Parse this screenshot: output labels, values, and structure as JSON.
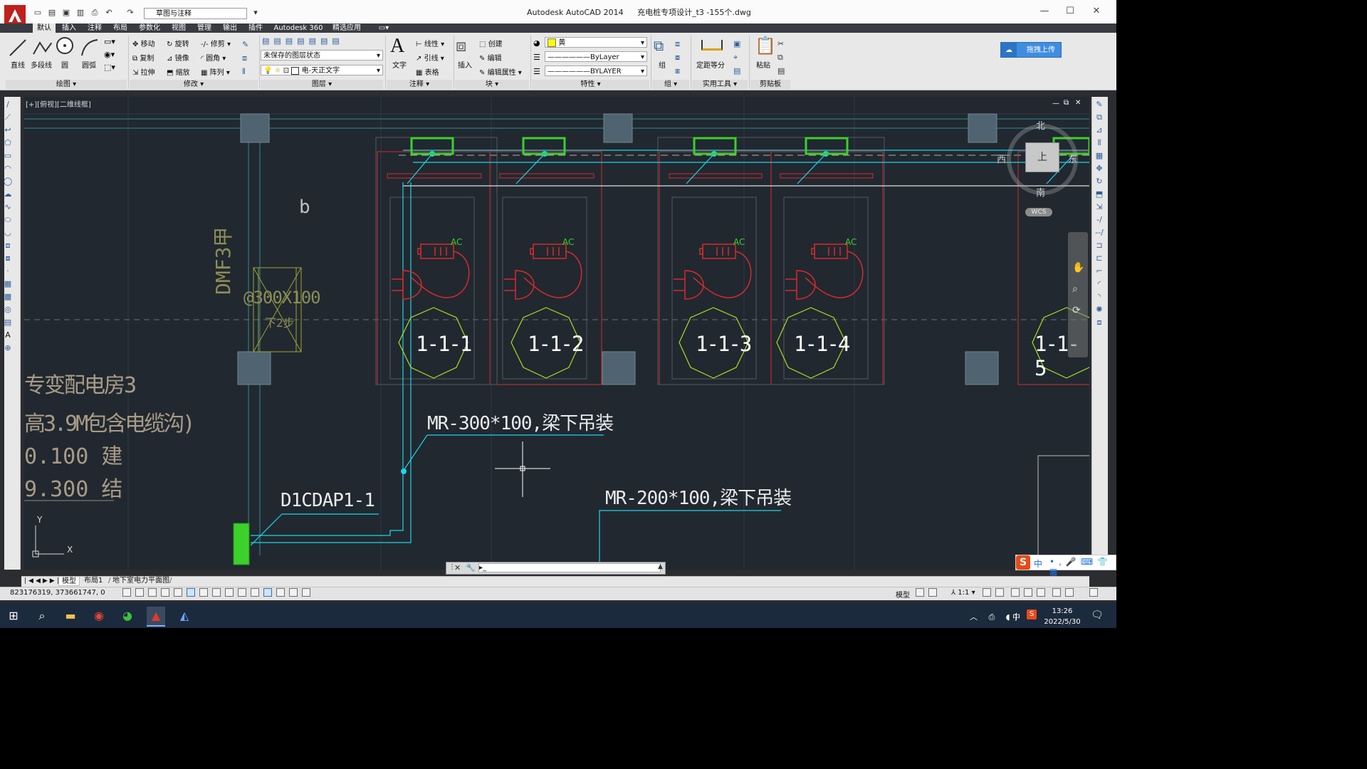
{
  "window": {
    "title": "Autodesk AutoCAD 2014",
    "file": "充电桩专项设计_t3 -155个.dwg",
    "workspace": "草图与注释"
  },
  "tabs": [
    "默认",
    "插入",
    "注释",
    "布局",
    "参数化",
    "视图",
    "管理",
    "输出",
    "插件",
    "Autodesk 360",
    "精选应用"
  ],
  "ribbon": {
    "draw": {
      "line": "直线",
      "polyline": "多段线",
      "circle": "圆",
      "arc": "圆弧",
      "panel": "绘图"
    },
    "modify": {
      "move": "移动",
      "rotate": "旋转",
      "trim": "修剪",
      "copy": "复制",
      "mirror": "镜像",
      "fillet": "圆角",
      "stretch": "拉伸",
      "scale": "缩放",
      "array": "阵列",
      "panel": "修改"
    },
    "layers": {
      "state": "未保存的图层状态",
      "current": "电-天正文字",
      "panel": "图层"
    },
    "annotation": {
      "text": "文字",
      "linear": "线性",
      "leader": "引线",
      "table": "表格",
      "panel": "注释"
    },
    "block": {
      "insert": "插入",
      "create": "创建",
      "edit": "编辑",
      "edit_attr": "编辑属性",
      "panel": "块"
    },
    "properties": {
      "color": "黄",
      "linetype": "ByLayer",
      "lineweight": "BYLAYER",
      "panel": "特性"
    },
    "groups": {
      "group": "组",
      "panel": "组"
    },
    "utilities": {
      "measure": "定距等分",
      "panel": "实用工具"
    },
    "clipboard": {
      "paste": "粘贴",
      "panel": "剪贴板"
    },
    "cloud_upload": "拖拽上传",
    "colors": {
      "accent": "#3f8de0",
      "red": "#d82a2a",
      "green": "#3bd12a",
      "cyan": "#1fd4e6",
      "yellow_green": "#b6e023"
    }
  },
  "viewport": {
    "label": "[+][俯视][二维线框]"
  },
  "viewcube": {
    "north": "北",
    "south": "南",
    "east": "东",
    "west": "西",
    "top": "上",
    "wcs": "WCS"
  },
  "drawing": {
    "ac_label": "AC",
    "stations": [
      "1-1-1",
      "1-1-2",
      "1-1-3",
      "1-1-4",
      "1-1-5"
    ],
    "mr300": "MR-300*100,梁下吊装",
    "mr200": "MR-200*100,梁下吊装",
    "panel_code": "D1CDAP1-1",
    "letter_b": "b",
    "dmf": "DMF3甲",
    "dmf_size": "@300X100",
    "dmf_note": "下2步",
    "room_name": "专变配电房3",
    "room_height": "高3.9M包含电缆沟)",
    "elev_arch": "0.100 建",
    "elev_struct": "9.300 结",
    "ucs_y": "Y",
    "ucs_x": "X"
  },
  "layout_tabs": [
    "模型",
    "布局1",
    "地下室电力平面图"
  ],
  "command_prompt": "",
  "status": {
    "coords": "823176319, 373661747, 0",
    "model": "模型",
    "scale": "1:1"
  },
  "ime": {
    "lang": "中",
    "label": "S"
  },
  "taskbar": {
    "time": "13:26",
    "date": "2022/5/30",
    "lang": "中"
  }
}
